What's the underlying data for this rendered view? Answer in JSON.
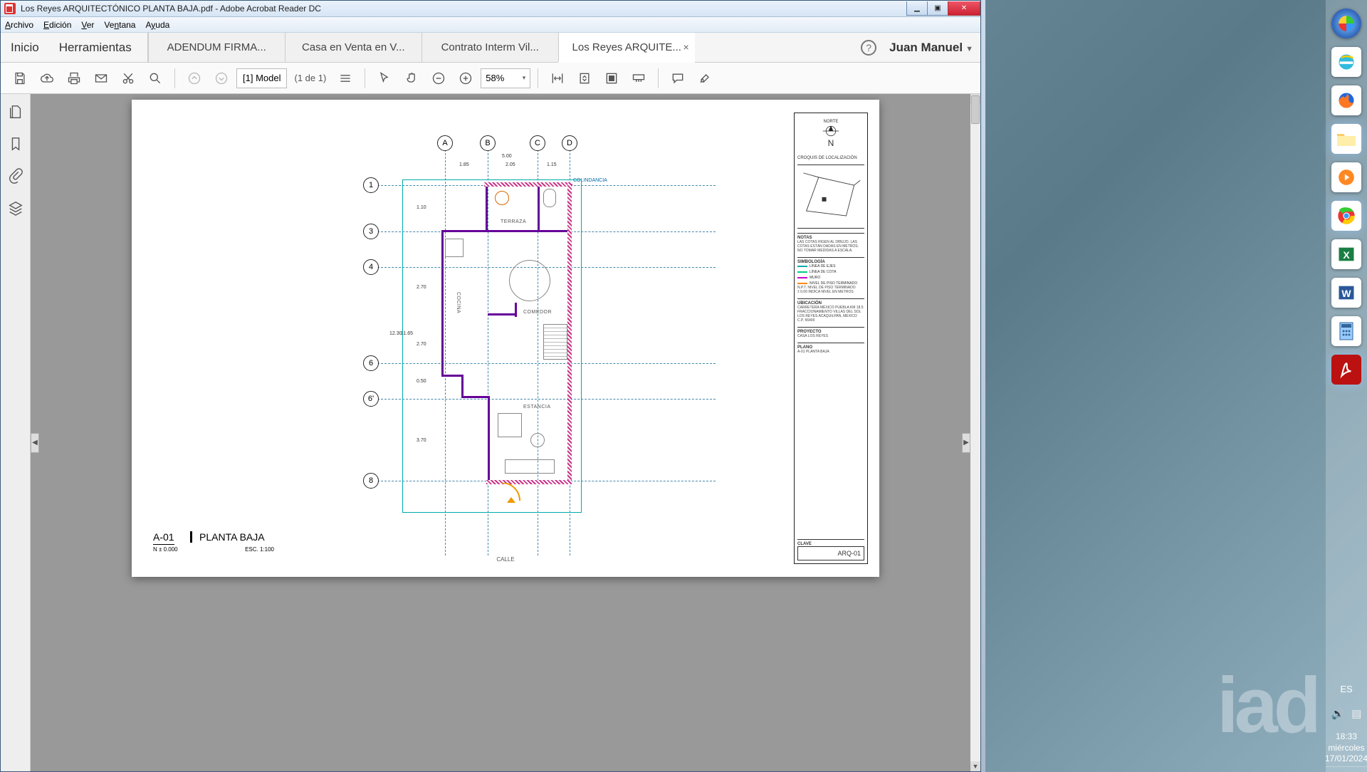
{
  "window": {
    "title": "Los Reyes ARQUITECTÓNICO PLANTA BAJA.pdf - Adobe Acrobat Reader DC",
    "min": "▁",
    "max": "▣",
    "close": "✕"
  },
  "menu": {
    "archivo": "Archivo",
    "edicion": "Edición",
    "ver": "Ver",
    "ventana": "Ventana",
    "ayuda": "Ayuda"
  },
  "tabs": {
    "home": "Inicio",
    "tools": "Herramientas",
    "docs": [
      {
        "label": "ADENDUM FIRMA..."
      },
      {
        "label": "Casa en Venta en V..."
      },
      {
        "label": "Contrato Interm Vil..."
      },
      {
        "label": "Los Reyes ARQUITE...",
        "active": true
      }
    ],
    "help": "?",
    "user": "Juan Manuel"
  },
  "toolbar": {
    "pagebox": "[1] Model",
    "pageinfo": "(1 de 1)",
    "zoom": "58%",
    "dd": "▾"
  },
  "plan": {
    "cols": [
      "A",
      "B",
      "C",
      "D"
    ],
    "rows": [
      "1",
      "3",
      "4",
      "6",
      "6'",
      "8"
    ],
    "dims_top": [
      "1.85",
      "2.05",
      "1.15",
      "5.00"
    ],
    "dims_left": [
      "1.10",
      "2.70",
      "2.70",
      "0.50",
      "3.70",
      "12.30",
      "11.65"
    ],
    "rooms": {
      "terraza": "TERRAZA",
      "cocina": "COCINA",
      "comedor": "COMEDOR",
      "estancia": "ESTANCIA",
      "calle": "CALLE"
    },
    "note": "COLINDANCIA"
  },
  "titlesheet": {
    "code": "A-01",
    "name": "PLANTA BAJA",
    "level": "N ± 0.000",
    "scale": "ESC. 1:100"
  },
  "tblock": {
    "north": "NORTE",
    "n": "N",
    "loc": "CROQUIS DE LOCALIZACIÓN",
    "notas_h": "NOTAS",
    "notes": "LAS COTAS RIGEN AL DIBUJO. LAS COTAS ESTÁN DADAS EN METROS. NO TOMAR MEDIDAS A ESCALA.",
    "simb_h": "SIMBOLOGÍA",
    "sym": [
      {
        "c": "#0aa",
        "t": "LÍNEA DE EJES"
      },
      {
        "c": "#0c8",
        "t": "LÍNEA DE COTA"
      },
      {
        "c": "#c0c",
        "t": "MURO"
      },
      {
        "c": "#f80",
        "t": "NIVEL DE PISO TERMINADO"
      }
    ],
    "simb2": "N.P.T.  NIVEL DE PISO TERMINADO\n± 0.00  INDICA NIVEL EN METROS",
    "ubic_h": "UBICACIÓN",
    "ubic": "CARRETERA MÉXICO PUEBLA KM 18.5 FRACCIONAMIENTO VILLAS DEL SOL LOS REYES ACAQUILPAN, MÉXICO C.P. 56400",
    "proy_h": "PROYECTO",
    "proy": "CASA LOS REYES",
    "plano_h": "PLANO",
    "plano": "A-01 PLANTA BAJA",
    "clave_h": "CLAVE",
    "clave": "ARQ-01"
  },
  "dock": {
    "lang": "ES",
    "time": "18:33",
    "day": "miércoles",
    "date": "17/01/2024"
  },
  "wm": "iad"
}
